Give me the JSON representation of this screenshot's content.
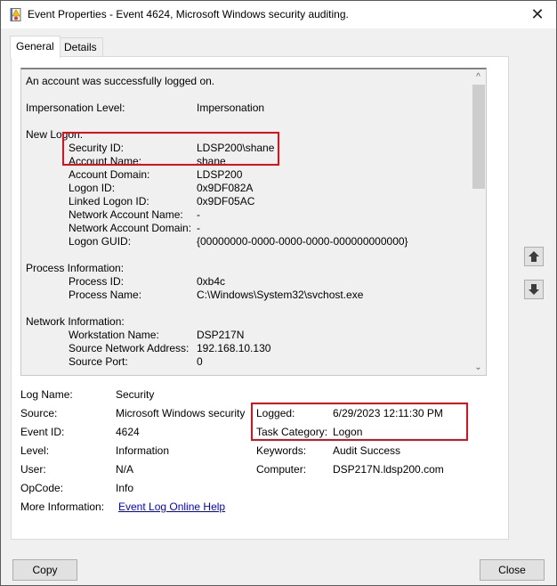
{
  "window": {
    "title": "Event Properties - Event 4624, Microsoft Windows security auditing.",
    "close_glyph": "✕"
  },
  "tabs": [
    {
      "label": "General",
      "active": true
    },
    {
      "label": "Details",
      "active": false
    }
  ],
  "description": {
    "headline": "An account was successfully logged on.",
    "impersonation": {
      "label": "Impersonation Level:",
      "value": "Impersonation"
    },
    "new_logon": {
      "header": "New Logon:",
      "fields": [
        {
          "label": "Security ID:",
          "value": "LDSP200\\shane"
        },
        {
          "label": "Account Name:",
          "value": "shane"
        },
        {
          "label": "Account Domain:",
          "value": "LDSP200"
        },
        {
          "label": "Logon ID:",
          "value": "0x9DF082A"
        },
        {
          "label": "Linked Logon ID:",
          "value": "0x9DF05AC"
        },
        {
          "label": "Network Account Name:",
          "value": "-"
        },
        {
          "label": "Network Account Domain:",
          "value": "-"
        },
        {
          "label": "Logon GUID:",
          "value": "{00000000-0000-0000-0000-000000000000}"
        }
      ]
    },
    "process_info": {
      "header": "Process Information:",
      "fields": [
        {
          "label": "Process ID:",
          "value": "0xb4c"
        },
        {
          "label": "Process Name:",
          "value": "C:\\Windows\\System32\\svchost.exe"
        }
      ]
    },
    "network_info": {
      "header": "Network Information:",
      "fields": [
        {
          "label": "Workstation Name:",
          "value": "DSP217N"
        },
        {
          "label": "Source Network Address:",
          "value": "192.168.10.130"
        },
        {
          "label": "Source Port:",
          "value": "0"
        }
      ]
    }
  },
  "scrollbar": {
    "up_glyph": "^",
    "down_glyph": "⌄"
  },
  "metadata": {
    "log_name": {
      "label": "Log Name:",
      "value": "Security"
    },
    "source": {
      "label": "Source:",
      "value": "Microsoft Windows security"
    },
    "event_id": {
      "label": "Event ID:",
      "value": "4624"
    },
    "level": {
      "label": "Level:",
      "value": "Information"
    },
    "user": {
      "label": "User:",
      "value": "N/A"
    },
    "opcode": {
      "label": "OpCode:",
      "value": "Info"
    },
    "more_info": {
      "label": "More Information:",
      "value": "Event Log Online Help"
    },
    "logged": {
      "label": "Logged:",
      "value": "6/29/2023 12:11:30 PM"
    },
    "task_category": {
      "label": "Task Category:",
      "value": "Logon"
    },
    "keywords": {
      "label": "Keywords:",
      "value": "Audit Success"
    },
    "computer": {
      "label": "Computer:",
      "value": "DSP217N.ldsp200.com"
    }
  },
  "buttons": {
    "copy": "Copy",
    "close": "Close"
  },
  "colors": {
    "highlight": "#e0101a",
    "link": "#0000ee"
  }
}
